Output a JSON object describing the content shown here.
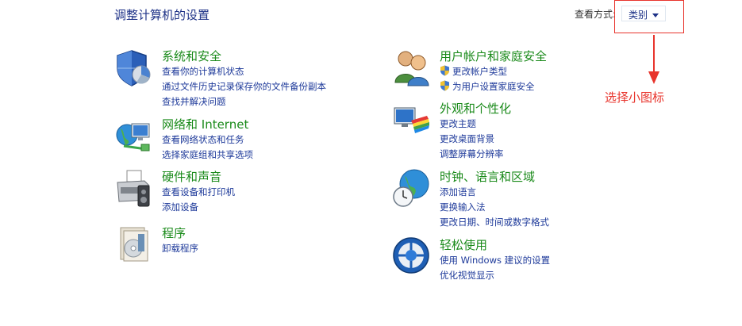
{
  "header": {
    "title": "调整计算机的设置",
    "view_label": "查看方式:",
    "view_value": "类别"
  },
  "annotation": {
    "text": "选择小图标",
    "color": "#e8342c"
  },
  "categories_left": [
    {
      "title": "系统和安全",
      "icon": "shield-icon",
      "links": [
        "查看你的计算机状态",
        "通过文件历史记录保存你的文件备份副本",
        "查找并解决问题"
      ]
    },
    {
      "title": "网络和 Internet",
      "icon": "network-icon",
      "links": [
        "查看网络状态和任务",
        "选择家庭组和共享选项"
      ]
    },
    {
      "title": "硬件和声音",
      "icon": "printer-icon",
      "links": [
        "查看设备和打印机",
        "添加设备"
      ]
    },
    {
      "title": "程序",
      "icon": "programs-icon",
      "links": [
        "卸载程序"
      ]
    }
  ],
  "categories_right": [
    {
      "title": "用户帐户和家庭安全",
      "icon": "users-icon",
      "links": [
        "更改帐户类型",
        "为用户设置家庭安全"
      ]
    },
    {
      "title": "外观和个性化",
      "icon": "appearance-icon",
      "links": [
        "更改主题",
        "更改桌面背景",
        "调整屏幕分辨率"
      ]
    },
    {
      "title": "时钟、语言和区域",
      "icon": "clock-globe-icon",
      "links": [
        "添加语言",
        "更换输入法",
        "更改日期、时间或数字格式"
      ]
    },
    {
      "title": "轻松使用",
      "icon": "ease-of-access-icon",
      "links": [
        "使用 Windows 建议的设置",
        "优化视觉显示"
      ]
    }
  ]
}
